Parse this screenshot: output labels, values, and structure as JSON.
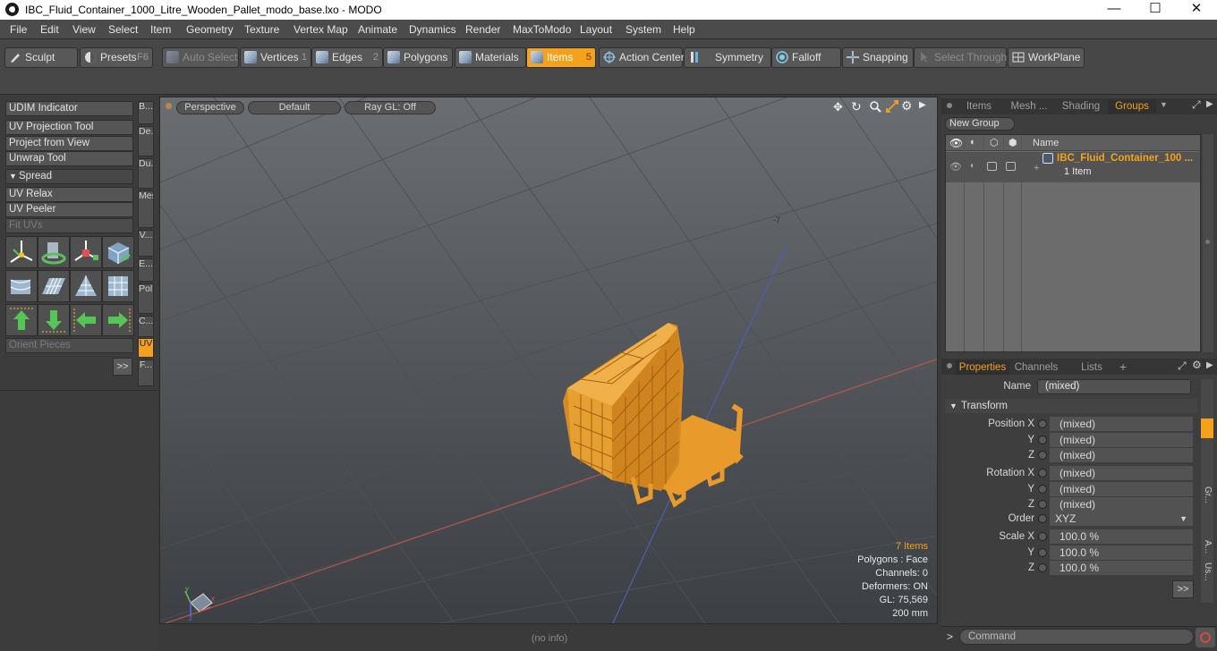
{
  "window": {
    "title": "IBC_Fluid_Container_1000_Litre_Wooden_Pallet_modo_base.lxo - MODO",
    "minimize": "—",
    "maximize": "☐",
    "close": "✕"
  },
  "menu": [
    "File",
    "Edit",
    "View",
    "Select",
    "Item",
    "Geometry",
    "Texture",
    "Vertex Map",
    "Animate",
    "Dynamics",
    "Render",
    "MaxToModo",
    "Layout",
    "System",
    "Help"
  ],
  "toolbar": {
    "sculpt": "Sculpt",
    "presets": "Presets",
    "presets_key": "F6",
    "auto_select": "Auto Select",
    "vertices": "Vertices",
    "vertices_key": "1",
    "edges": "Edges",
    "edges_key": "2",
    "polygons": "Polygons",
    "materials": "Materials",
    "items": "Items",
    "items_key": "5",
    "action_center": "Action Center",
    "symmetry": "Symmetry",
    "falloff": "Falloff",
    "snapping": "Snapping",
    "select_through": "Select Through",
    "workplane": "WorkPlane"
  },
  "left": {
    "udim": "UDIM Indicator",
    "uv_projection": "UV Projection Tool",
    "project_view": "Project from View",
    "unwrap": "Unwrap Tool",
    "spread": "Spread",
    "uv_relax": "UV Relax",
    "uv_peeler": "UV Peeler",
    "fit_uvs": "Fit UVs",
    "orient": "Orient Pieces",
    "more": ">>",
    "vtabs": [
      "B...",
      "De...",
      "Du...",
      "Mes...",
      "V...",
      "E...",
      "Pol...",
      "C...",
      "UV",
      "F..."
    ]
  },
  "viewport": {
    "perspective": "Perspective",
    "default": "Default",
    "raygl": "Ray GL: Off",
    "items": "7 Items",
    "polygons": "Polygons : Face",
    "channels": "Channels: 0",
    "deformers": "Deformers: ON",
    "gl": "GL: 75,569",
    "size": "200 mm",
    "axis_label": "-7"
  },
  "status": "(no info)",
  "groups": {
    "tabs": [
      "Items",
      "Mesh ...",
      "Shading",
      "Groups"
    ],
    "new_group": "New Group",
    "col_name": "Name",
    "item_name": "IBC_Fluid_Container_100 ...",
    "item_count": "1 Item"
  },
  "props": {
    "tabs": [
      "Properties",
      "Channels",
      "Lists",
      "+"
    ],
    "name_label": "Name",
    "name_value": "(mixed)",
    "transform": "Transform",
    "position_label": "Position X",
    "rotation_label": "Rotation X",
    "scale_label": "Scale X",
    "y": "Y",
    "z": "Z",
    "mixed": "(mixed)",
    "order_label": "Order",
    "order_value": "XYZ",
    "scale_value": "100.0 %",
    "more": ">>",
    "side_tabs": [
      "Gr...",
      "A...",
      "Us..."
    ]
  },
  "command": {
    "prompt": ">",
    "placeholder": "Command"
  },
  "colors": {
    "accent": "#f4a21c",
    "mesh": "#f7a73a"
  }
}
